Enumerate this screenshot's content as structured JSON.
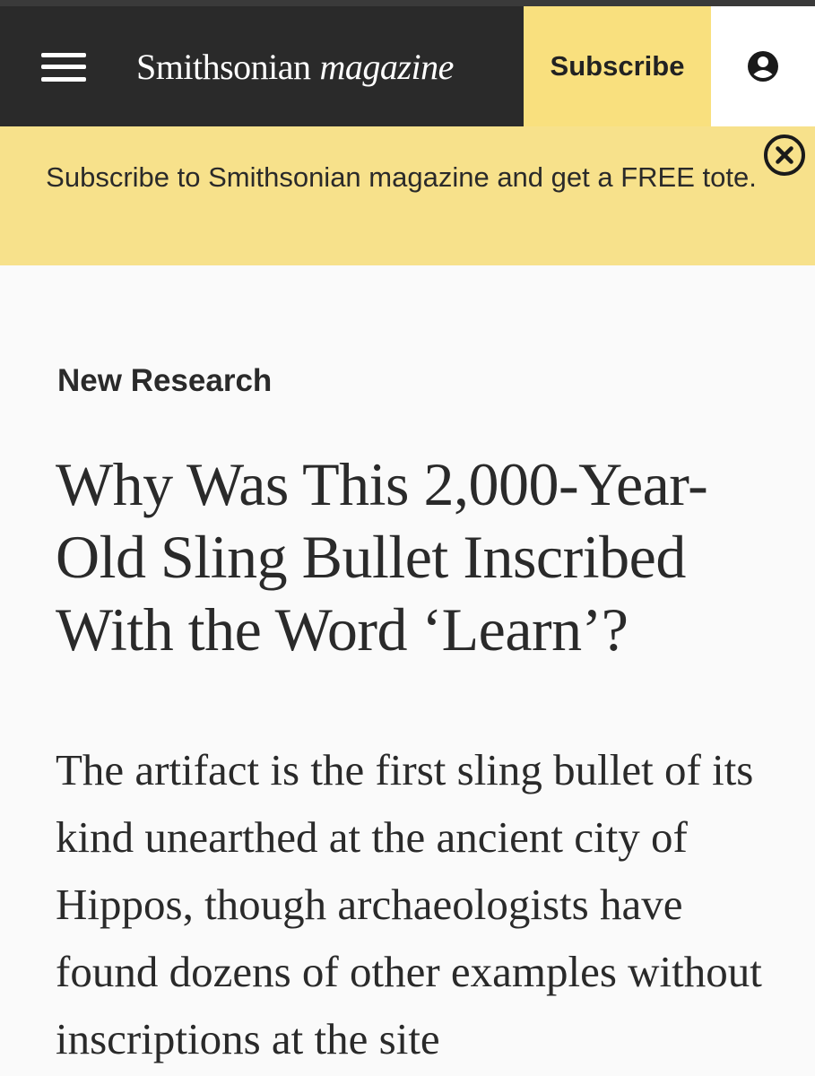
{
  "header": {
    "logo_main": "Smithsonian",
    "logo_italic": "magazine",
    "subscribe_label": "Subscribe",
    "menu_icon": "hamburger-menu-icon",
    "account_icon": "user-account-icon"
  },
  "promo": {
    "text": "Subscribe to Smithsonian magazine and get a FREE tote.",
    "close_icon": "close-icon"
  },
  "article": {
    "category": "New Research",
    "headline": "Why Was This 2,000-Year-Old Sling Bullet Inscribed With the Word ‘Learn’?",
    "dek": "The artifact is the first sling bullet of its kind unearthed at the ancient city of Hippos, though archaeologists have found dozens of other examples without inscriptions at the site"
  },
  "colors": {
    "nav_dark": "#2a2a2a",
    "subscribe_yellow": "#f9e07e",
    "promo_yellow": "#f7e18b",
    "text": "#2a2a2a",
    "page_background": "#fafafa"
  }
}
